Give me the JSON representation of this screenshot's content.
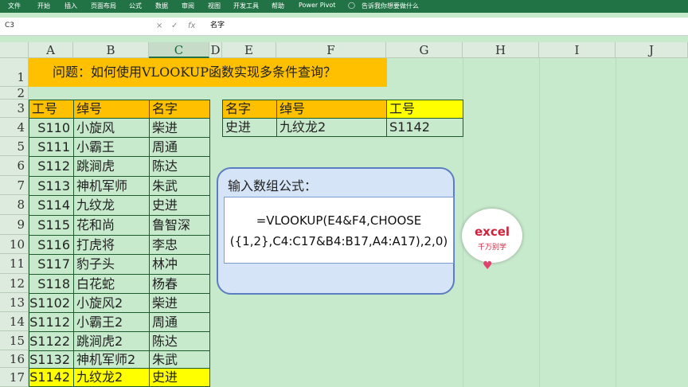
{
  "ribbon": {
    "tabs": [
      "文件",
      "开始",
      "插入",
      "页面布局",
      "公式",
      "数据",
      "审阅",
      "视图",
      "开发工具",
      "帮助",
      "Power Pivot"
    ],
    "tell_me": "告诉我你想要做什么"
  },
  "formula_bar": {
    "name_box": "C3",
    "value": "名字",
    "cancel": "×",
    "enter": "✓",
    "fx": "fx"
  },
  "columns": [
    "A",
    "B",
    "C",
    "D",
    "E",
    "F",
    "G",
    "H",
    "I",
    "J"
  ],
  "rows": [
    "1",
    "2",
    "3",
    "4",
    "5",
    "6",
    "7",
    "8",
    "9",
    "10",
    "11",
    "12",
    "13",
    "14",
    "15",
    "16",
    "17"
  ],
  "title": "问题：如何使用VLOOKUP函数实现多条件查询？",
  "table": {
    "headers": [
      "工号",
      "绰号",
      "名字"
    ],
    "rows": [
      [
        "S110",
        "小旋风",
        "柴进"
      ],
      [
        "S111",
        "小霸王",
        "周通"
      ],
      [
        "S112",
        "跳涧虎",
        "陈达"
      ],
      [
        "S113",
        "神机军师",
        "朱武"
      ],
      [
        "S114",
        "九纹龙",
        "史进"
      ],
      [
        "S115",
        "花和尚",
        "鲁智深"
      ],
      [
        "S116",
        "打虎将",
        "李忠"
      ],
      [
        "S117",
        "豹子头",
        "林冲"
      ],
      [
        "S118",
        "白花蛇",
        "杨春"
      ],
      [
        "S1102",
        "小旋风2",
        "柴进"
      ],
      [
        "S1112",
        "小霸王2",
        "周通"
      ],
      [
        "S1122",
        "跳涧虎2",
        "陈达"
      ],
      [
        "S1132",
        "神机军师2",
        "朱武"
      ],
      [
        "S1142",
        "九纹龙2",
        "史进"
      ]
    ]
  },
  "lookup": {
    "headers": [
      "名字",
      "绰号",
      "工号"
    ],
    "values": [
      "史进",
      "九纹龙2",
      "S1142"
    ]
  },
  "callout": {
    "title": "输入数组公式：",
    "line1": "=VLOOKUP(E4&F4,CHOOSE",
    "line2": "({1,2},C4:C17&B4:B17,A4:A17),2,0)"
  },
  "logo": {
    "text": "excel",
    "subtitle": "千万别学"
  },
  "colors": {
    "accent": "#217346",
    "header_fill": "#ffc000",
    "highlight": "#ffff00",
    "sheet_bg": "#c7e9cc"
  }
}
